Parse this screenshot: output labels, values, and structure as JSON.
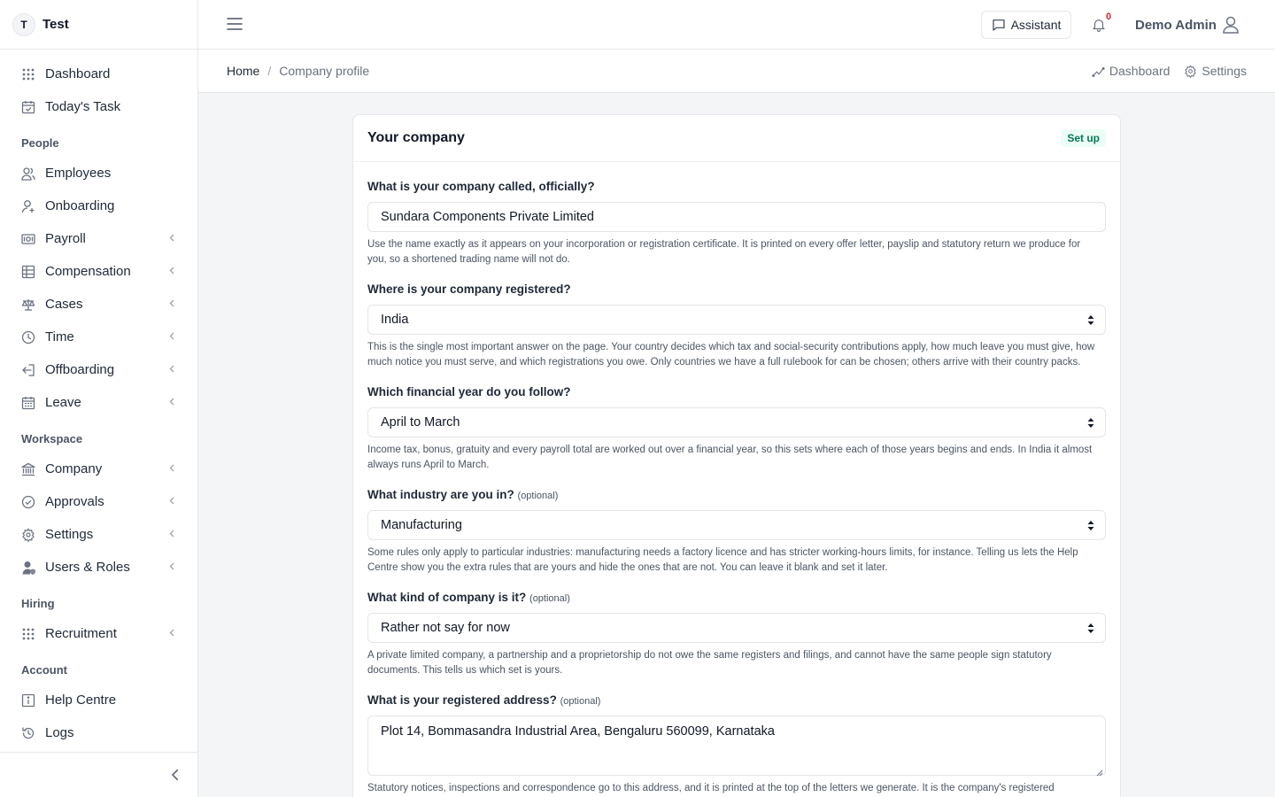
{
  "brand": {
    "initial": "T",
    "name": "Test"
  },
  "sidebar": {
    "top_items": [
      {
        "label": "Dashboard",
        "icon": "grid-icon",
        "chevron": false
      },
      {
        "label": "Today's Task",
        "icon": "calendar-check-icon",
        "chevron": false
      }
    ],
    "sections": [
      {
        "title": "People",
        "items": [
          {
            "label": "Employees",
            "icon": "users-icon",
            "chevron": false
          },
          {
            "label": "Onboarding",
            "icon": "user-plus-icon",
            "chevron": false
          },
          {
            "label": "Payroll",
            "icon": "money-icon",
            "chevron": true
          },
          {
            "label": "Compensation",
            "icon": "table-icon",
            "chevron": true
          },
          {
            "label": "Cases",
            "icon": "scale-icon",
            "chevron": true
          },
          {
            "label": "Time",
            "icon": "clock-icon",
            "chevron": true
          },
          {
            "label": "Offboarding",
            "icon": "logout-icon",
            "chevron": true
          },
          {
            "label": "Leave",
            "icon": "calendar-icon",
            "chevron": true
          }
        ]
      },
      {
        "title": "Workspace",
        "items": [
          {
            "label": "Company",
            "icon": "bank-icon",
            "chevron": true
          },
          {
            "label": "Approvals",
            "icon": "check-circle-icon",
            "chevron": true
          },
          {
            "label": "Settings",
            "icon": "gear-icon",
            "chevron": true
          },
          {
            "label": "Users & Roles",
            "icon": "user-shield-icon",
            "chevron": true
          }
        ]
      },
      {
        "title": "Hiring",
        "items": [
          {
            "label": "Recruitment",
            "icon": "grid-icon",
            "chevron": true
          }
        ]
      },
      {
        "title": "Account",
        "items": [
          {
            "label": "Help Centre",
            "icon": "info-icon",
            "chevron": false
          },
          {
            "label": "Logs",
            "icon": "history-icon",
            "chevron": false
          }
        ]
      }
    ]
  },
  "topbar": {
    "assistant_label": "Assistant",
    "notification_count": "0",
    "user_name": "Demo Admin"
  },
  "breadcrumb": {
    "home": "Home",
    "separator": "/",
    "current": "Company profile"
  },
  "subbar": {
    "dashboard_link": "Dashboard",
    "settings_link": "Settings"
  },
  "card": {
    "title": "Your company",
    "badge": "Set up",
    "fields": [
      {
        "label": "What is your company called, officially?",
        "optional": "",
        "type": "text",
        "value": "Sundara Components Private Limited",
        "help": "Use the name exactly as it appears on your incorporation or registration certificate. It is printed on every offer letter, payslip and statutory return we produce for you, so a shortened trading name will not do."
      },
      {
        "label": "Where is your company registered?",
        "optional": "",
        "type": "select",
        "value": "India",
        "help": "This is the single most important answer on the page. Your country decides which tax and social-security contributions apply, how much leave you must give, how much notice you must serve, and which registrations you owe. Only countries we have a full rulebook for can be chosen; others arrive with their country packs."
      },
      {
        "label": "Which financial year do you follow?",
        "optional": "",
        "type": "select",
        "value": "April to March",
        "help": "Income tax, bonus, gratuity and every payroll total are worked out over a financial year, so this sets where each of those years begins and ends. In India it almost always runs April to March."
      },
      {
        "label": "What industry are you in?",
        "optional": "(optional)",
        "type": "select",
        "value": "Manufacturing",
        "help": "Some rules only apply to particular industries: manufacturing needs a factory licence and has stricter working-hours limits, for instance. Telling us lets the Help Centre show you the extra rules that are yours and hide the ones that are not. You can leave it blank and set it later."
      },
      {
        "label": "What kind of company is it?",
        "optional": "(optional)",
        "type": "select",
        "value": "Rather not say for now",
        "help": "A private limited company, a partnership and a proprietorship do not owe the same registers and filings, and cannot have the same people sign statutory documents. This tells us which set is yours."
      },
      {
        "label": "What is your registered address?",
        "optional": "(optional)",
        "type": "textarea",
        "value": "Plot 14, Bommasandra Industrial Area, Bengaluru 560099, Karnataka",
        "help": "Statutory notices, inspections and correspondence go to this address, and it is printed at the top of the letters we generate. It is the company's registered"
      }
    ]
  }
}
